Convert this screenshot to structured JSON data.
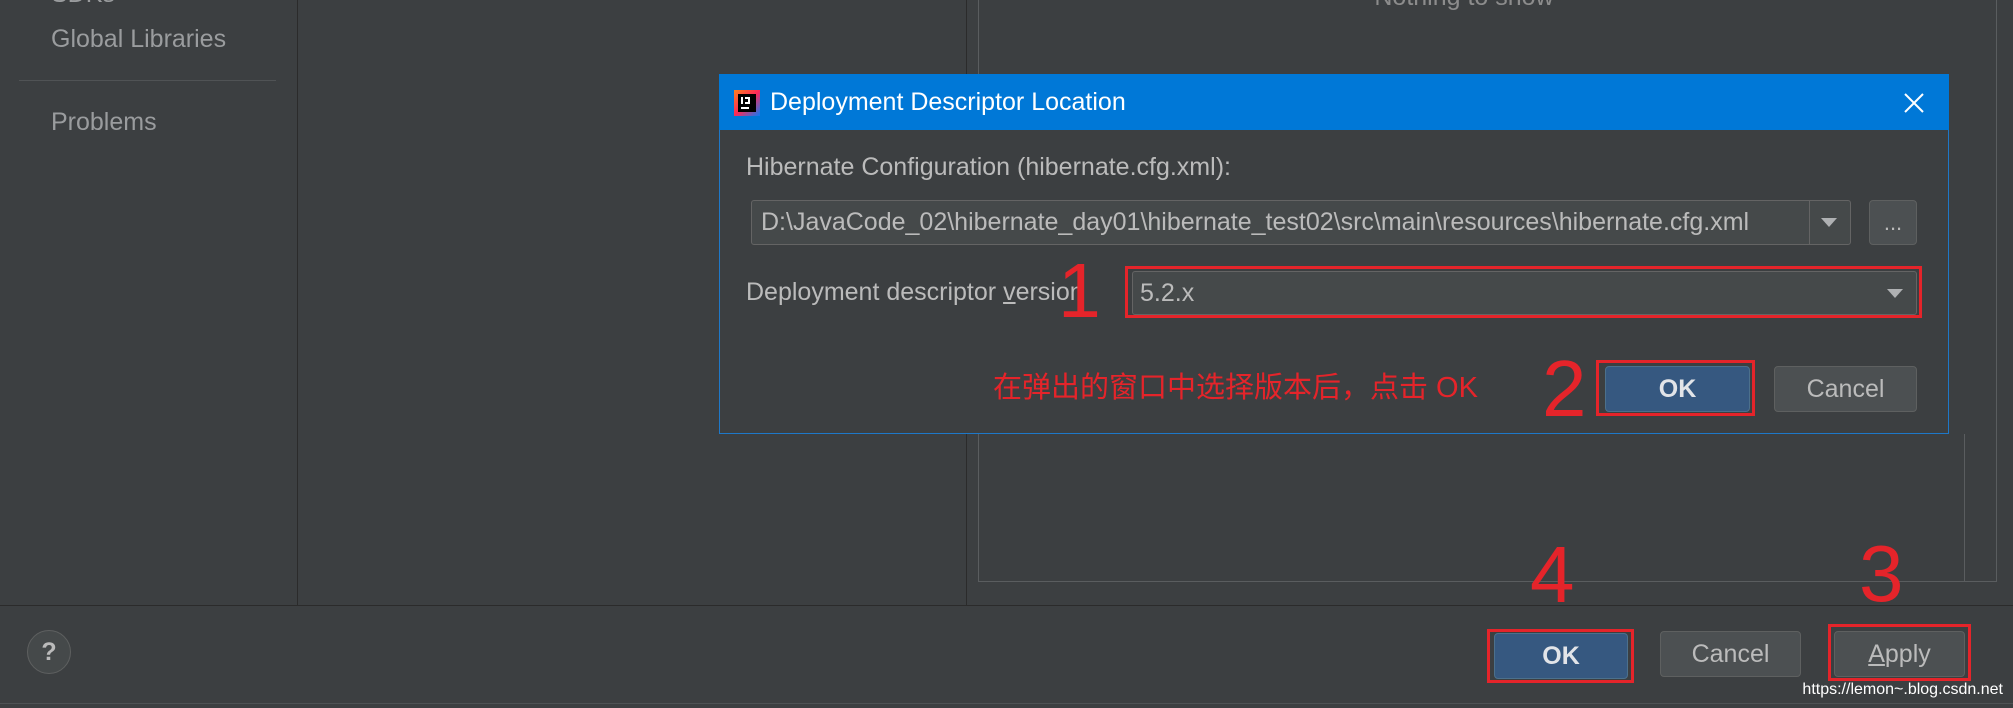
{
  "sidebar": {
    "items": [
      {
        "label": "SDKs"
      },
      {
        "label": "Global Libraries"
      },
      {
        "label": "Problems"
      }
    ]
  },
  "details": {
    "empty_text": "Nothing to show"
  },
  "footer": {
    "help_label": "?",
    "ok_label": "OK",
    "cancel_label": "Cancel",
    "apply_label": {
      "mnemonic": "A",
      "rest": "pply"
    }
  },
  "dialog": {
    "title": "Deployment Descriptor Location",
    "config_label": "Hibernate Configuration (hibernate.cfg.xml):",
    "config_path": "D:\\JavaCode_02\\hibernate_day01\\hibernate_test02\\src\\main\\resources\\hibernate.cfg.xml",
    "browse_label": "...",
    "version_label": {
      "before": "Deployment descriptor ",
      "mnemonic": "v",
      "after": "ersion"
    },
    "version_value": "5.2.x",
    "ok_label": "OK",
    "cancel_label": "Cancel"
  },
  "annotations": {
    "steps": [
      "1",
      "2",
      "3",
      "4"
    ],
    "instruction": "在弹出的窗口中选择版本后，点击 OK"
  },
  "watermark": "https://lemon~.blog.csdn.net",
  "icons": {
    "app": "intellij-idea-icon",
    "close": "close-icon",
    "help": "help-icon",
    "dropdown": "chevron-down-icon"
  },
  "colors": {
    "background": "#3c3f41",
    "text": "#bbbbbb",
    "title_bar": "#0078d7",
    "primary_button": "#365880",
    "annotation_red": "#e5242a"
  }
}
